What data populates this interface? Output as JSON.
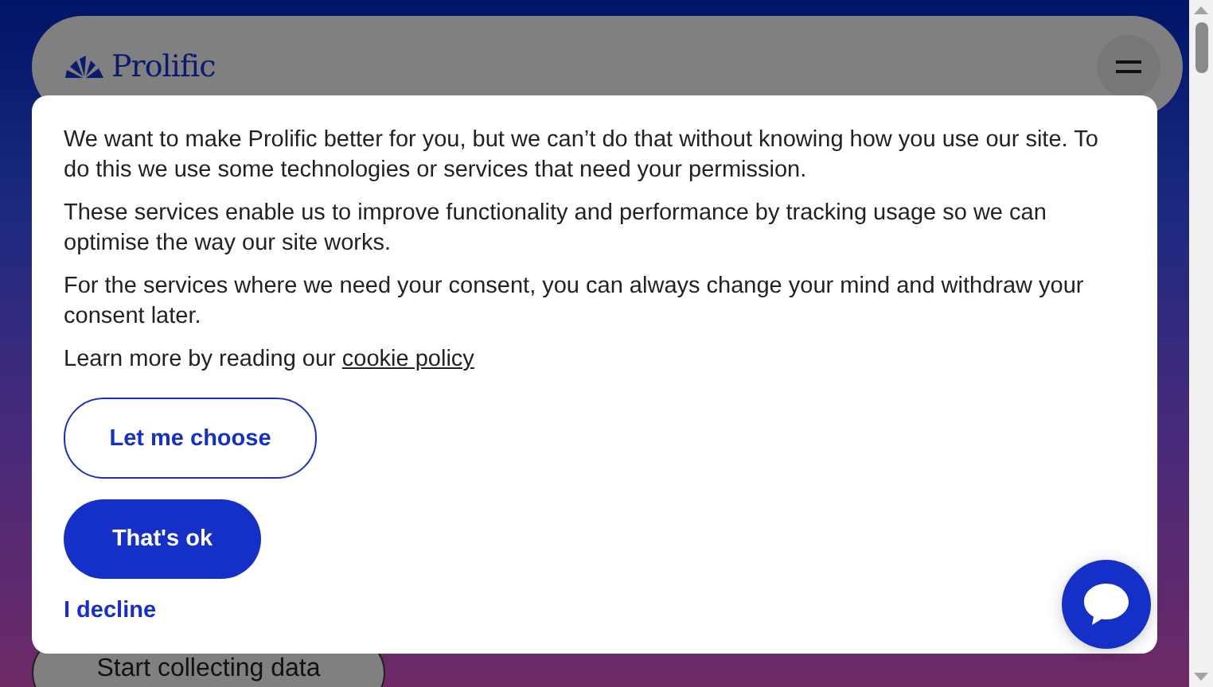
{
  "header": {
    "logo": "Prolific"
  },
  "hero": {
    "button": "Start collecting data"
  },
  "consent": {
    "paragraphs": [
      "We want to make Prolific better for you, but we can’t do that without knowing how you use our site. To do this we use some technologies or services that need your permission.",
      "These services enable us to improve functionality and performance by tracking usage so we can optimise the way our site works.",
      "For the services where we need your consent, you can always change your mind and withdraw your consent later."
    ],
    "learn_more": "Learn more by reading our ",
    "policy_link": "cookie policy",
    "buttons": [
      {
        "label": "Let me choose",
        "kind": "outline"
      },
      {
        "label": "That's ok",
        "kind": "filled"
      },
      {
        "label": "I decline",
        "kind": "link"
      }
    ]
  }
}
